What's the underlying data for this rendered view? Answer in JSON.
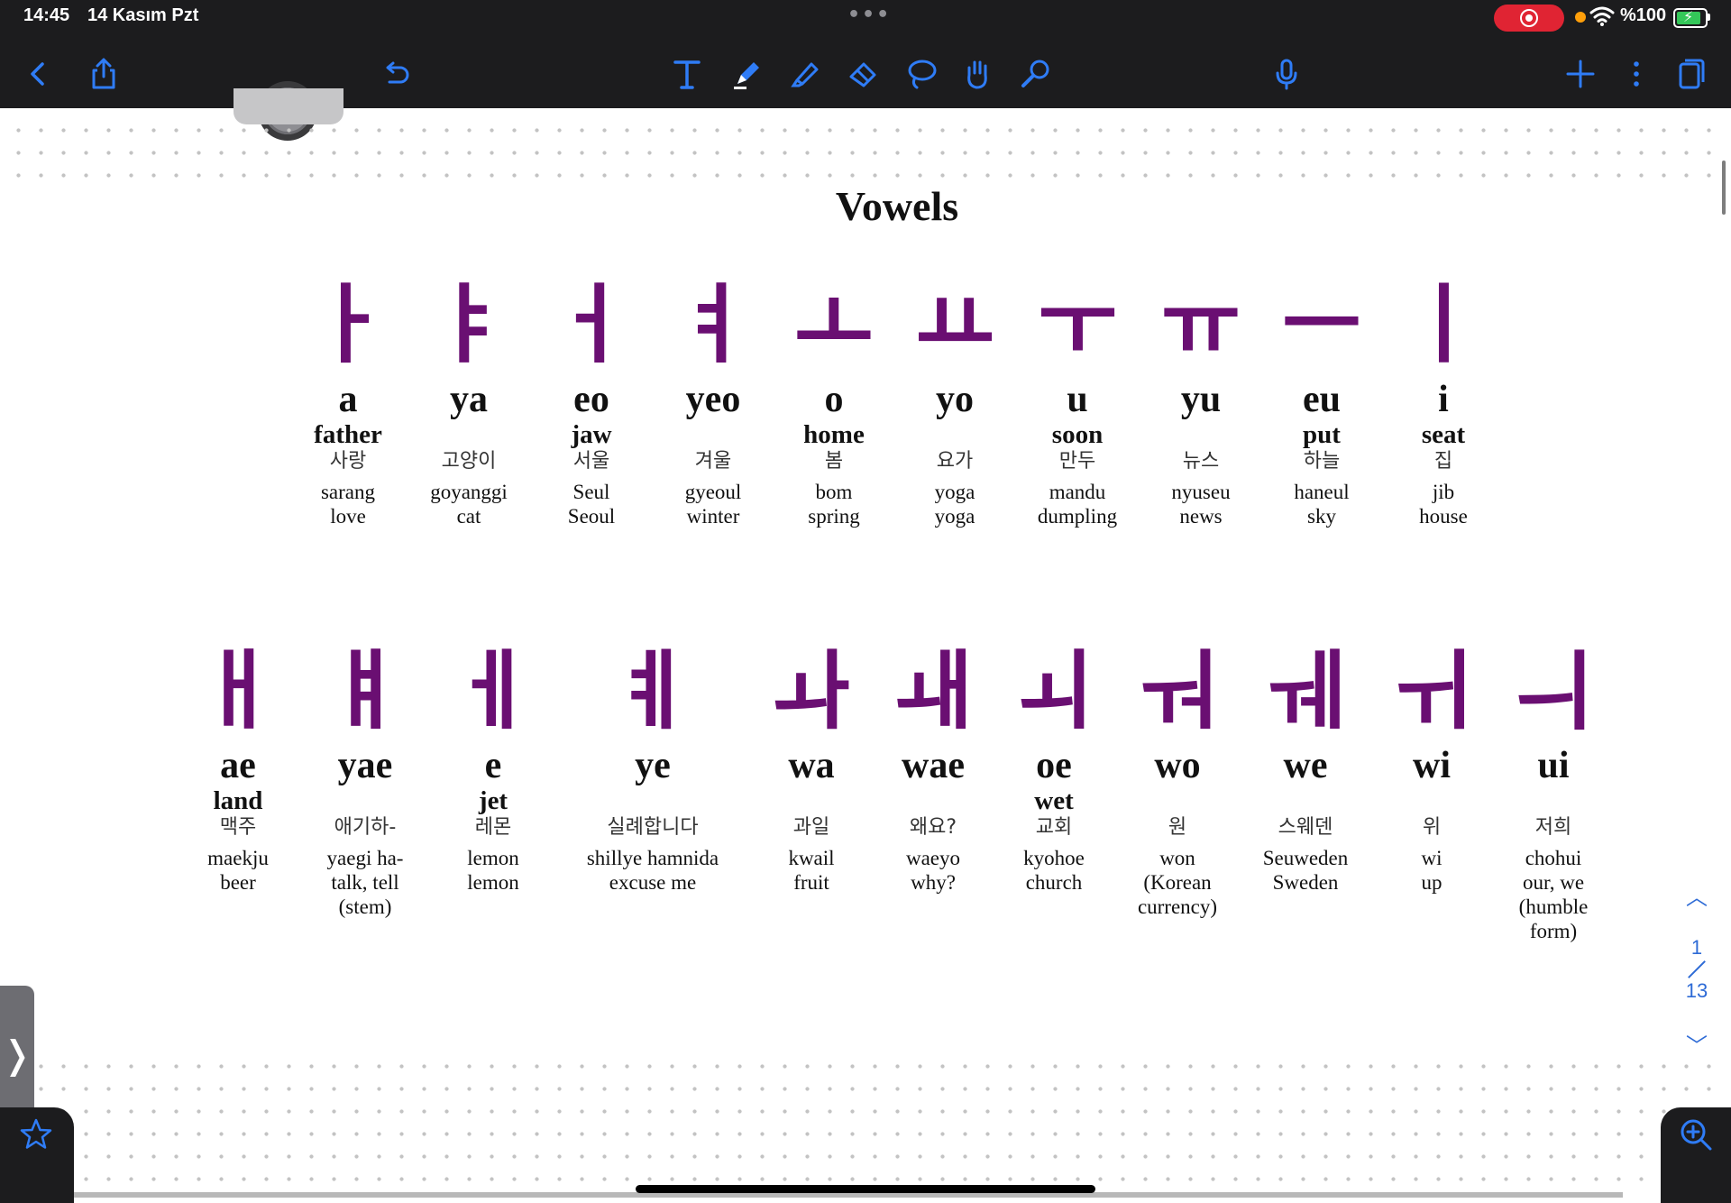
{
  "status_bar": {
    "time": "14:45",
    "date": "14 Kasım Pzt",
    "battery": "%100"
  },
  "toolbar": {
    "icons": [
      "back-icon",
      "share-icon",
      "undo-icon",
      "text-tool-icon",
      "pen-icon",
      "highlighter-icon",
      "eraser-icon",
      "lasso-icon",
      "hand-icon",
      "laser-pointer-icon",
      "microphone-icon",
      "add-icon",
      "more-icon",
      "pages-icon"
    ]
  },
  "page": {
    "title": "Vowels",
    "row1": [
      {
        "glyph": "ㅏ",
        "rom": "a",
        "eng": "father",
        "kor": "사랑",
        "ex": "sarang\nlove"
      },
      {
        "glyph": "ㅑ",
        "rom": "ya",
        "eng": "",
        "kor": "고양이",
        "ex": "goyanggi\ncat"
      },
      {
        "glyph": "ㅓ",
        "rom": "eo",
        "eng": "jaw",
        "kor": "서울",
        "ex": "Seul\nSeoul"
      },
      {
        "glyph": "ㅕ",
        "rom": "yeo",
        "eng": "",
        "kor": "겨울",
        "ex": "gyeoul\nwinter"
      },
      {
        "glyph": "ㅗ",
        "rom": "o",
        "eng": "home",
        "kor": "봄",
        "ex": "bom\nspring"
      },
      {
        "glyph": "ㅛ",
        "rom": "yo",
        "eng": "",
        "kor": "요가",
        "ex": "yoga\nyoga"
      },
      {
        "glyph": "ㅜ",
        "rom": "u",
        "eng": "soon",
        "kor": "만두",
        "ex": "mandu\ndumpling"
      },
      {
        "glyph": "ㅠ",
        "rom": "yu",
        "eng": "",
        "kor": "뉴스",
        "ex": "nyuseu\nnews"
      },
      {
        "glyph": "ㅡ",
        "rom": "eu",
        "eng": "put",
        "kor": "하늘",
        "ex": "haneul\nsky"
      },
      {
        "glyph": "ㅣ",
        "rom": "i",
        "eng": "seat",
        "kor": "집",
        "ex": "jib\nhouse"
      }
    ],
    "row2": [
      {
        "glyph": "ㅐ",
        "rom": "ae",
        "eng": "land",
        "kor": "맥주",
        "ex": "maekju\nbeer"
      },
      {
        "glyph": "ㅒ",
        "rom": "yae",
        "eng": "",
        "kor": "애기하-",
        "ex": "yaegi ha-\ntalk, tell\n(stem)"
      },
      {
        "glyph": "ㅔ",
        "rom": "e",
        "eng": "jet",
        "kor": "레몬",
        "ex": "lemon\nlemon"
      },
      {
        "glyph": "ㅖ",
        "rom": "ye",
        "eng": "",
        "kor": "실례합니다",
        "ex": "shillye hamnida\nexcuse me"
      },
      {
        "glyph": "ㅘ",
        "rom": "wa",
        "eng": "",
        "kor": "과일",
        "ex": "kwail\nfruit"
      },
      {
        "glyph": "ㅙ",
        "rom": "wae",
        "eng": "",
        "kor": "왜요?",
        "ex": "waeyo\nwhy?"
      },
      {
        "glyph": "ㅚ",
        "rom": "oe",
        "eng": "wet",
        "kor": "교회",
        "ex": "kyohoe\nchurch"
      },
      {
        "glyph": "ㅝ",
        "rom": "wo",
        "eng": "",
        "kor": "원",
        "ex": "won\n(Korean\ncurrency)"
      },
      {
        "glyph": "ㅞ",
        "rom": "we",
        "eng": "",
        "kor": "스웨덴",
        "ex": "Seuweden\nSweden"
      },
      {
        "glyph": "ㅟ",
        "rom": "wi",
        "eng": "",
        "kor": "위",
        "ex": "wi\nup"
      },
      {
        "glyph": "ㅢ",
        "rom": "ui",
        "eng": "",
        "kor": "저희",
        "ex": "chohui\nour, we\n(humble\nform)"
      }
    ]
  },
  "pager": {
    "current": "1",
    "total": "13"
  },
  "side_tab": {
    "label": "❭"
  },
  "colors": {
    "glyph": "#6a0f72",
    "accent": "#2e6bd6",
    "toolbar": "#1c1c1e",
    "record": "#e02433"
  }
}
